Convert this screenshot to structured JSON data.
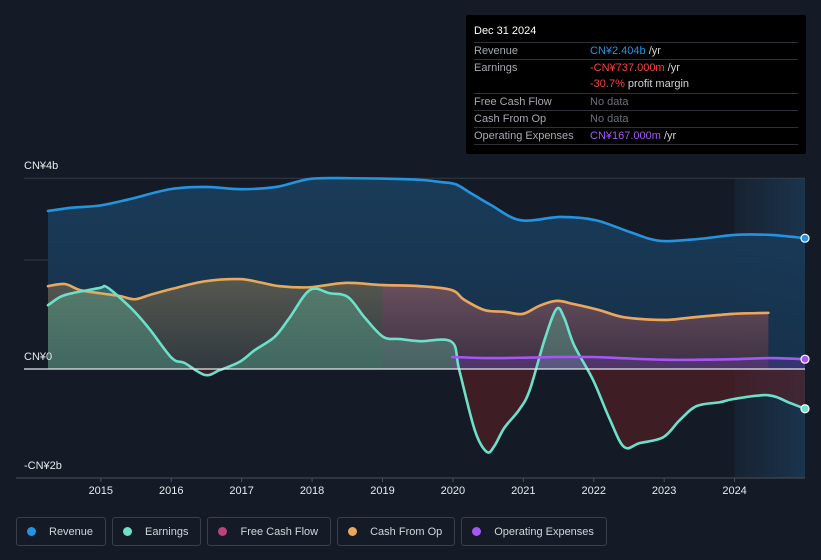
{
  "tooltip": {
    "date": "Dec 31 2024",
    "rows": [
      {
        "label": "Revenue",
        "value": "CN¥2.404b",
        "unit": " /yr",
        "color": "#2394df"
      },
      {
        "label": "Earnings",
        "value": "-CN¥737.000m",
        "unit": " /yr",
        "color": "#ff4040"
      },
      {
        "label": "",
        "value": "-30.7%",
        "unit": " profit margin",
        "color": "#ff4040"
      },
      {
        "label": "Free Cash Flow",
        "value": "No data",
        "unit": "",
        "color": "#6b7079"
      },
      {
        "label": "Cash From Op",
        "value": "No data",
        "unit": "",
        "color": "#6b7079"
      },
      {
        "label": "Operating Expenses",
        "value": "CN¥167.000m",
        "unit": " /yr",
        "color": "#a855f7"
      }
    ]
  },
  "legend": [
    {
      "label": "Revenue",
      "color": "#2394df"
    },
    {
      "label": "Earnings",
      "color": "#6ce1c9"
    },
    {
      "label": "Free Cash Flow",
      "color": "#c1407e"
    },
    {
      "label": "Cash From Op",
      "color": "#e8a95a"
    },
    {
      "label": "Operating Expenses",
      "color": "#a855f7"
    }
  ],
  "chart_data": {
    "type": "area",
    "title": "",
    "xlabel": "",
    "ylabel": "",
    "y_unit": "CN¥ billions",
    "xlim": [
      2014.25,
      2025.0
    ],
    "ylim": [
      -2.0,
      3.5
    ],
    "y_tick_labels": [
      {
        "label": "CN¥4b",
        "value": 3.5
      },
      {
        "label": "CN¥0",
        "value": 0
      },
      {
        "label": "-CN¥2b",
        "value": -2.0
      }
    ],
    "y_gridlines": [
      3.5,
      2.0,
      0,
      -2.0
    ],
    "x_ticks": [
      2015,
      2016,
      2017,
      2018,
      2019,
      2020,
      2021,
      2022,
      2023,
      2024
    ],
    "x_tick_labels": [
      "2015",
      "2016",
      "2017",
      "2018",
      "2019",
      "2020",
      "2021",
      "2022",
      "2023",
      "2024"
    ],
    "forecast_shade_start": 2024.0,
    "series": [
      {
        "name": "Revenue",
        "color": "#2394df",
        "end_marker": true,
        "points": [
          [
            2014.25,
            2.9
          ],
          [
            2014.59,
            2.96
          ],
          [
            2014.99,
            3.0
          ],
          [
            2015.42,
            3.12
          ],
          [
            2015.99,
            3.3
          ],
          [
            2016.49,
            3.34
          ],
          [
            2016.99,
            3.3
          ],
          [
            2017.49,
            3.34
          ],
          [
            2017.98,
            3.49
          ],
          [
            2018.55,
            3.5
          ],
          [
            2019.12,
            3.49
          ],
          [
            2019.54,
            3.47
          ],
          [
            2019.83,
            3.43
          ],
          [
            2020.04,
            3.39
          ],
          [
            2020.25,
            3.23
          ],
          [
            2020.54,
            3.01
          ],
          [
            2020.96,
            2.73
          ],
          [
            2021.53,
            2.79
          ],
          [
            2022.03,
            2.73
          ],
          [
            2022.52,
            2.51
          ],
          [
            2022.95,
            2.35
          ],
          [
            2023.52,
            2.39
          ],
          [
            2024.0,
            2.46
          ],
          [
            2024.51,
            2.46
          ],
          [
            2025.0,
            2.4
          ]
        ]
      },
      {
        "name": "Earnings",
        "color": "#6ce1c9",
        "end_marker": true,
        "points": [
          [
            2014.25,
            1.17
          ],
          [
            2014.42,
            1.32
          ],
          [
            2014.59,
            1.39
          ],
          [
            2014.99,
            1.49
          ],
          [
            2015.06,
            1.52
          ],
          [
            2015.2,
            1.39
          ],
          [
            2015.48,
            1.05
          ],
          [
            2015.7,
            0.72
          ],
          [
            2016.01,
            0.2
          ],
          [
            2016.19,
            0.11
          ],
          [
            2016.48,
            -0.11
          ],
          [
            2016.69,
            -0.02
          ],
          [
            2016.97,
            0.13
          ],
          [
            2017.19,
            0.35
          ],
          [
            2017.47,
            0.59
          ],
          [
            2017.68,
            0.94
          ],
          [
            2017.97,
            1.45
          ],
          [
            2018.25,
            1.39
          ],
          [
            2018.51,
            1.32
          ],
          [
            2018.75,
            0.94
          ],
          [
            2019.01,
            0.59
          ],
          [
            2019.25,
            0.55
          ],
          [
            2019.53,
            0.51
          ],
          [
            2019.98,
            0.5
          ],
          [
            2020.09,
            -0.02
          ],
          [
            2020.31,
            -1.12
          ],
          [
            2020.48,
            -1.52
          ],
          [
            2020.59,
            -1.41
          ],
          [
            2020.73,
            -1.08
          ],
          [
            2020.94,
            -0.75
          ],
          [
            2021.09,
            -0.39
          ],
          [
            2021.3,
            0.53
          ],
          [
            2021.47,
            1.1
          ],
          [
            2021.58,
            0.94
          ],
          [
            2021.72,
            0.44
          ],
          [
            2021.99,
            -0.2
          ],
          [
            2022.22,
            -0.9
          ],
          [
            2022.43,
            -1.43
          ],
          [
            2022.65,
            -1.36
          ],
          [
            2022.99,
            -1.25
          ],
          [
            2023.22,
            -0.94
          ],
          [
            2023.46,
            -0.68
          ],
          [
            2023.79,
            -0.61
          ],
          [
            2023.99,
            -0.55
          ],
          [
            2024.47,
            -0.48
          ],
          [
            2024.78,
            -0.62
          ],
          [
            2025.0,
            -0.73
          ]
        ]
      },
      {
        "name": "Free Cash Flow",
        "color": "#c1407e",
        "points": [
          [
            2019.0,
            1.54
          ],
          [
            2019.53,
            1.52
          ],
          [
            2019.98,
            1.45
          ],
          [
            2020.16,
            1.27
          ],
          [
            2020.45,
            1.08
          ],
          [
            2020.73,
            1.05
          ],
          [
            2020.99,
            1.01
          ],
          [
            2021.23,
            1.16
          ],
          [
            2021.47,
            1.25
          ],
          [
            2021.72,
            1.19
          ],
          [
            2022.08,
            1.08
          ],
          [
            2022.43,
            0.95
          ],
          [
            2022.99,
            0.9
          ],
          [
            2023.35,
            0.94
          ],
          [
            2023.97,
            1.01
          ],
          [
            2024.48,
            1.03
          ]
        ]
      },
      {
        "name": "Cash From Op",
        "color": "#e8a95a",
        "points": [
          [
            2014.25,
            1.52
          ],
          [
            2014.49,
            1.56
          ],
          [
            2014.7,
            1.45
          ],
          [
            2014.99,
            1.39
          ],
          [
            2015.27,
            1.34
          ],
          [
            2015.48,
            1.28
          ],
          [
            2015.7,
            1.36
          ],
          [
            2016.01,
            1.47
          ],
          [
            2016.48,
            1.61
          ],
          [
            2016.97,
            1.65
          ],
          [
            2017.26,
            1.59
          ],
          [
            2017.54,
            1.52
          ],
          [
            2017.97,
            1.5
          ],
          [
            2018.47,
            1.58
          ],
          [
            2019.0,
            1.54
          ],
          [
            2019.53,
            1.52
          ],
          [
            2019.98,
            1.45
          ],
          [
            2020.16,
            1.27
          ],
          [
            2020.45,
            1.08
          ],
          [
            2020.73,
            1.05
          ],
          [
            2020.99,
            1.01
          ],
          [
            2021.23,
            1.16
          ],
          [
            2021.47,
            1.25
          ],
          [
            2021.72,
            1.19
          ],
          [
            2022.08,
            1.08
          ],
          [
            2022.43,
            0.95
          ],
          [
            2022.99,
            0.9
          ],
          [
            2023.35,
            0.94
          ],
          [
            2023.97,
            1.01
          ],
          [
            2024.48,
            1.03
          ]
        ]
      },
      {
        "name": "Operating Expenses",
        "color": "#a855f7",
        "end_marker": true,
        "points": [
          [
            2019.99,
            0.22
          ],
          [
            2020.52,
            0.2
          ],
          [
            2021.09,
            0.21
          ],
          [
            2021.47,
            0.22
          ],
          [
            2022.0,
            0.22
          ],
          [
            2022.36,
            0.2
          ],
          [
            2022.99,
            0.17
          ],
          [
            2023.5,
            0.17
          ],
          [
            2023.99,
            0.18
          ],
          [
            2024.51,
            0.2
          ],
          [
            2025.0,
            0.18
          ]
        ]
      }
    ]
  }
}
